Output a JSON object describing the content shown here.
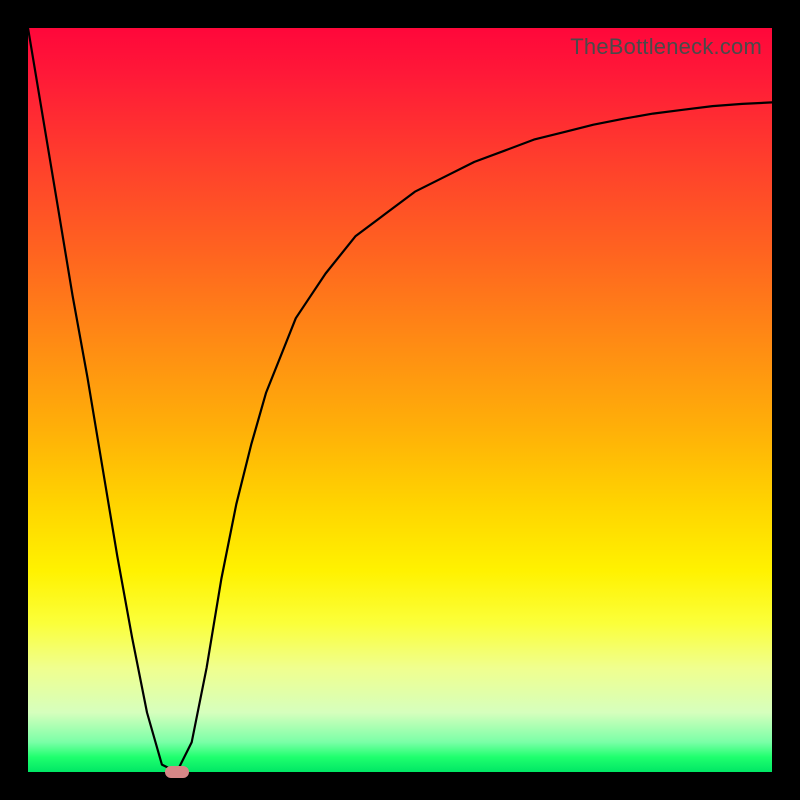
{
  "watermark": "TheBottleneck.com",
  "colors": {
    "frame": "#000000",
    "curve": "#000000",
    "marker": "#d68787",
    "gradient_top": "#ff073a",
    "gradient_bottom": "#00e765"
  },
  "chart_data": {
    "type": "line",
    "title": "",
    "xlabel": "",
    "ylabel": "",
    "xlim": [
      0,
      100
    ],
    "ylim": [
      0,
      100
    ],
    "x": [
      0,
      2,
      4,
      6,
      8,
      10,
      12,
      14,
      16,
      18,
      20,
      22,
      24,
      26,
      28,
      30,
      32,
      34,
      36,
      38,
      40,
      44,
      48,
      52,
      56,
      60,
      64,
      68,
      72,
      76,
      80,
      84,
      88,
      92,
      96,
      100
    ],
    "values": [
      100,
      88,
      76,
      64,
      53,
      41,
      29,
      18,
      8,
      1,
      0,
      4,
      14,
      26,
      36,
      44,
      51,
      56,
      61,
      64,
      67,
      72,
      75,
      78,
      80,
      82,
      83.5,
      85,
      86,
      87,
      87.8,
      88.5,
      89,
      89.5,
      89.8,
      90
    ],
    "marker": {
      "x": 20,
      "y": 0
    },
    "legend": false,
    "grid": false
  }
}
